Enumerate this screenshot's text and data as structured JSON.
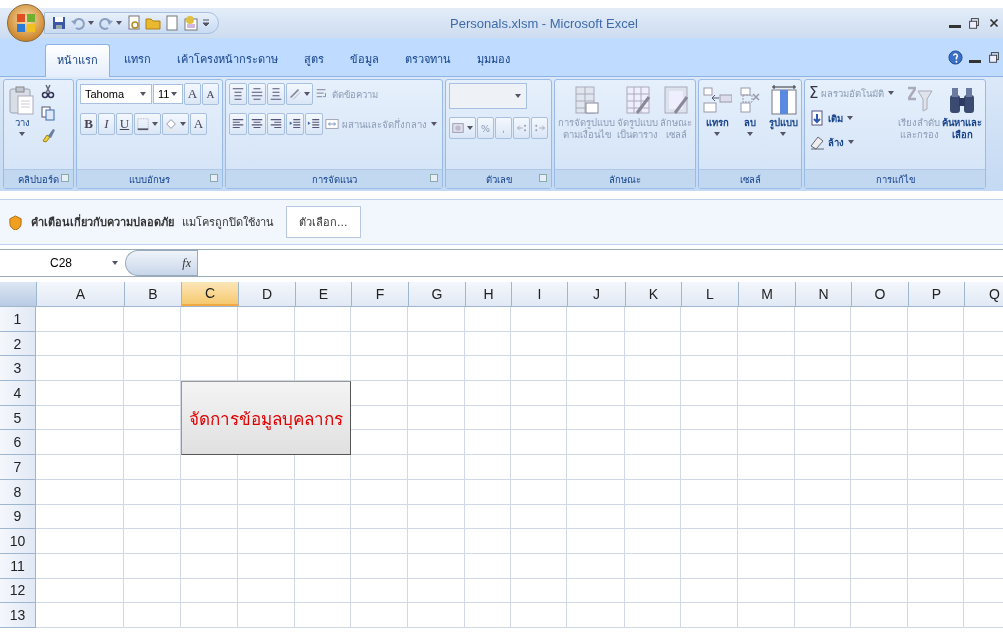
{
  "window": {
    "title": "Personals.xlsm - Microsoft Excel"
  },
  "tabs": [
    {
      "label": "หน้าแรก",
      "selected": true
    },
    {
      "label": "แทรก",
      "selected": false
    },
    {
      "label": "เค้าโครงหน้ากระดาษ",
      "selected": false
    },
    {
      "label": "สูตร",
      "selected": false
    },
    {
      "label": "ข้อมูล",
      "selected": false
    },
    {
      "label": "ตรวจทาน",
      "selected": false
    },
    {
      "label": "มุมมอง",
      "selected": false
    }
  ],
  "ribbon": [
    {
      "kind": "clipboard",
      "label": "คลิปบอร์ด",
      "paste_label": "วาง"
    },
    {
      "kind": "font",
      "label": "แบบอักษร",
      "font_name": "Tahoma",
      "font_size": "11",
      "grow_label": "A",
      "shrink_label": "A",
      "format_buttons": [
        "B",
        "I",
        "U"
      ],
      "font_color_label": "A"
    },
    {
      "kind": "alignment",
      "label": "การจัดแนว",
      "wrap_label": "ตัดข้อความ",
      "merge_label": "ผสานและจัดกึ่งกลาง",
      "disabled": true
    },
    {
      "kind": "number",
      "label": "ตัวเลข",
      "percent_label": "%",
      "comma_label": ",",
      "disabled": true
    },
    {
      "kind": "styles",
      "label": "ลักษณะ",
      "items": [
        {
          "label": "การจัดรูปแบบ\nตามเงื่อนไข",
          "disabled": true
        },
        {
          "label": "จัดรูปแบบ\nเป็นตาราง",
          "disabled": true
        },
        {
          "label": "ลักษณะ\nเซลล์",
          "disabled": true
        }
      ]
    },
    {
      "kind": "cells",
      "label": "เซลล์",
      "items": [
        {
          "label": "แทรก",
          "disabled": false
        },
        {
          "label": "ลบ",
          "disabled": false
        },
        {
          "label": "รูปแบบ",
          "disabled": false
        }
      ]
    },
    {
      "kind": "editing",
      "label": "การแก้ไข",
      "autosum_symbol": "Σ",
      "autosum_label": "ผลรวมอัตโนมัติ",
      "autosum_disabled": true,
      "fill_label": "เติม",
      "clear_label": "ล้าง",
      "sort_label": "เรียงลำดับ\nและกรอง",
      "sort_disabled": true,
      "find_label": "ค้นหาและ\nเลือก"
    }
  ],
  "security_bar": {
    "title": "คำเตือนเกี่ยวกับความปลอดภัย",
    "message": "แมโครถูกปิดใช้งาน",
    "button": "ตัวเลือก..."
  },
  "formula_bar": {
    "name_box": "C28",
    "fx_label": "fx"
  },
  "sheet": {
    "columns": [
      {
        "label": "A",
        "selected": false
      },
      {
        "label": "B",
        "selected": false
      },
      {
        "label": "C",
        "selected": true
      },
      {
        "label": "D",
        "selected": false
      },
      {
        "label": "E",
        "selected": false
      },
      {
        "label": "F",
        "selected": false
      },
      {
        "label": "G",
        "selected": false
      },
      {
        "label": "H",
        "selected": false
      },
      {
        "label": "I",
        "selected": false
      },
      {
        "label": "J",
        "selected": false
      },
      {
        "label": "K",
        "selected": false
      },
      {
        "label": "L",
        "selected": false
      },
      {
        "label": "M",
        "selected": false
      },
      {
        "label": "N",
        "selected": false
      },
      {
        "label": "O",
        "selected": false
      },
      {
        "label": "P",
        "selected": false
      },
      {
        "label": "Q",
        "selected": false
      }
    ],
    "rows": [
      "1",
      "2",
      "3",
      "4",
      "5",
      "6",
      "7",
      "8",
      "9",
      "10",
      "11",
      "12",
      "13"
    ],
    "form_button": {
      "label": "จัดการข้อมูลบุคลากร"
    }
  }
}
